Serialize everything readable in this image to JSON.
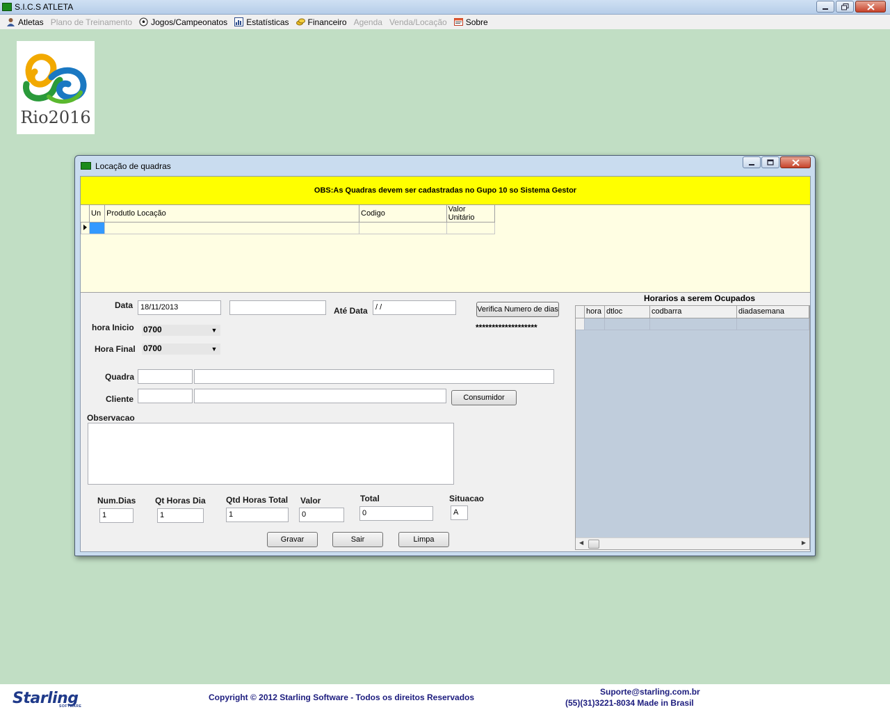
{
  "app": {
    "title": "S.I.C.S ATLETA",
    "menu": [
      {
        "label": "Atletas",
        "icon": "user-icon",
        "enabled": true
      },
      {
        "label": "Plano de Treinamento",
        "icon": "",
        "enabled": false
      },
      {
        "label": "Jogos/Campeonatos",
        "icon": "soccer-ball-icon",
        "enabled": true
      },
      {
        "label": "Estatísticas",
        "icon": "chart-icon",
        "enabled": true
      },
      {
        "label": "Financeiro",
        "icon": "coins-icon",
        "enabled": true
      },
      {
        "label": "Agenda",
        "icon": "",
        "enabled": false
      },
      {
        "label": "Venda/Locação",
        "icon": "",
        "enabled": false
      },
      {
        "label": "Sobre",
        "icon": "info-window-icon",
        "enabled": true
      }
    ]
  },
  "logo": {
    "text": "Rio2016"
  },
  "window": {
    "title": "Locação de quadras",
    "banner": "OBS:As Quadras devem ser cadastradas no Gupo 10 so Sistema Gestor",
    "product_grid": {
      "columns": [
        "Un",
        "Produtlo Locação",
        "Codigo",
        "Valor Unitário"
      ]
    },
    "form": {
      "data_label": "Data",
      "data_value": "18/11/2013",
      "data_extra_value": "",
      "ate_data_label": "Até Data",
      "ate_data_value": " / /",
      "verifica_button": "Verifica Numero de dias",
      "stars": "*******************",
      "hora_inicio_label": "hora Inicio",
      "hora_inicio_value": "0700",
      "hora_final_label": "Hora Final",
      "hora_final_value": "0700",
      "quadra_label": "Quadra",
      "quadra_code": "",
      "quadra_name": "",
      "cliente_label": "Cliente",
      "cliente_code": "",
      "cliente_name": "",
      "consumidor_button": "Consumidor",
      "observacao_label": "Observacao",
      "observacao_value": "",
      "num_dias_label": "Num.Dias",
      "num_dias_value": "1",
      "qt_horas_dia_label": "Qt Horas Dia",
      "qt_horas_dia_value": "1",
      "qtd_horas_total_label": "Qtd Horas Total",
      "qtd_horas_total_value": "1",
      "valor_label": "Valor",
      "valor_value": "0",
      "total_label": "Total",
      "total_value": "0",
      "situacao_label": "Situacao",
      "situacao_value": "A",
      "gravar_button": "Gravar",
      "sair_button": "Sair",
      "limpa_button": "Limpa"
    },
    "horarios": {
      "title": "Horarios a serem Ocupados",
      "columns": [
        "hora",
        "dtloc",
        "codbarra",
        "diadasemana"
      ]
    }
  },
  "footer": {
    "brand": "Starling",
    "brand_sub": "SOFTWARE",
    "copyright": "Copyright © 2012 Starling Software - Todos os direitos Reservados",
    "email": "Suporte@starling.com.br",
    "phone": "(55)(31)3221-8034 Made in Brasil"
  }
}
